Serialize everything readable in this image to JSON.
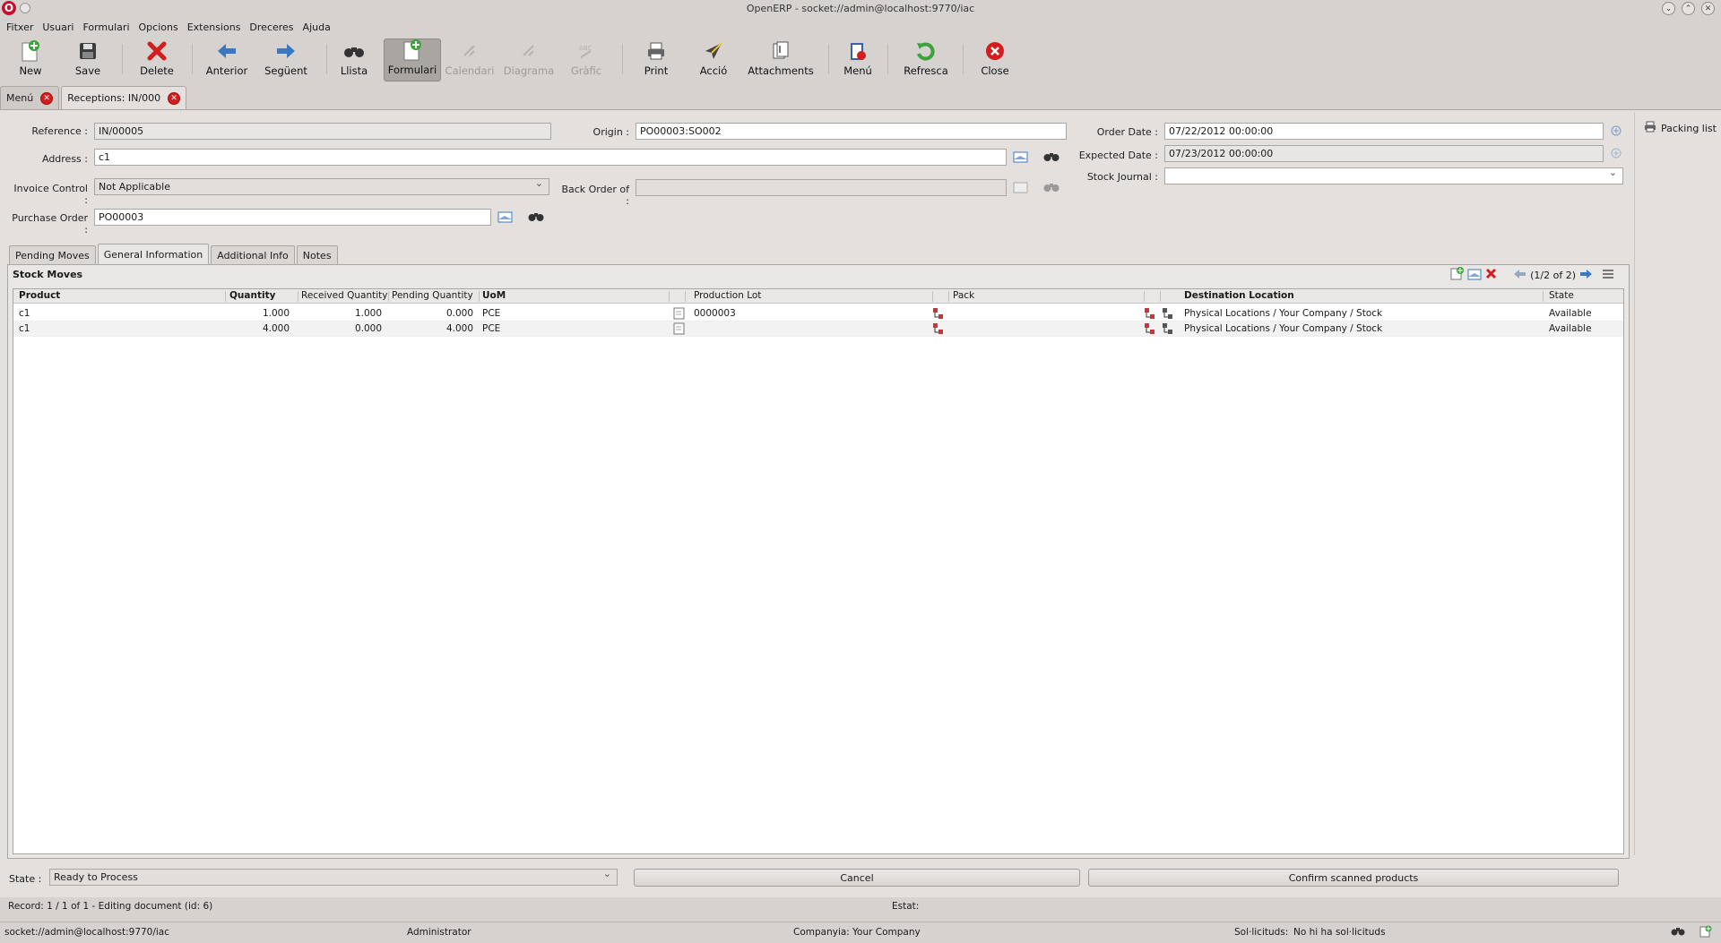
{
  "window": {
    "title": "OpenERP - socket://admin@localhost:9770/iac",
    "logo_letter": "O"
  },
  "menubar": [
    "Fitxer",
    "Usuari",
    "Formulari",
    "Opcions",
    "Extensions",
    "Dreceres",
    "Ajuda"
  ],
  "toolbar": {
    "new": "New",
    "save": "Save",
    "delete": "Delete",
    "prev": "Anterior",
    "next": "Següent",
    "list": "Llista",
    "form": "Formulari",
    "calendar": "Calendari",
    "diagram": "Diagrama",
    "graph": "Gràfic",
    "print": "Print",
    "action": "Acció",
    "attachments": "Attachments",
    "menu": "Menú",
    "refresh": "Refresca",
    "close": "Close"
  },
  "doc_tabs": {
    "menu": "Menú",
    "receptions": "Receptions: IN/000"
  },
  "form": {
    "reference_label": "Reference :",
    "reference": "IN/00005",
    "origin_label": "Origin :",
    "origin": "PO00003:SO002",
    "order_date_label": "Order Date :",
    "order_date": "07/22/2012  00:00:00",
    "address_label": "Address :",
    "address": "c1",
    "expected_date_label": "Expected Date :",
    "expected_date": "07/23/2012  00:00:00",
    "invoice_control_label": "Invoice Control :",
    "invoice_control": "Not Applicable",
    "back_order_label": "Back Order of :",
    "back_order": "",
    "stock_journal_label": "Stock Journal :",
    "stock_journal": "",
    "purchase_order_label": "Purchase Order :",
    "purchase_order": "PO00003"
  },
  "side": {
    "packing_list": "Packing list"
  },
  "inner_tabs": [
    "Pending Moves",
    "General Information",
    "Additional Info",
    "Notes"
  ],
  "stock_moves": {
    "title": "Stock Moves",
    "pager": "(1/2 of 2)",
    "columns": {
      "product": "Product",
      "quantity": "Quantity",
      "received": "Received Quantity",
      "pending": "Pending Quantity",
      "uom": "UoM",
      "lot": "Production Lot",
      "pack": "Pack",
      "destination": "Destination Location",
      "state": "State"
    },
    "rows": [
      {
        "product": "c1",
        "quantity": "1.000",
        "received": "1.000",
        "pending": "0.000",
        "uom": "PCE",
        "lot": "0000003",
        "pack": "",
        "destination": "Physical Locations / Your Company / Stock",
        "state": "Available"
      },
      {
        "product": "c1",
        "quantity": "4.000",
        "received": "0.000",
        "pending": "4.000",
        "uom": "PCE",
        "lot": "",
        "pack": "",
        "destination": "Physical Locations / Your Company / Stock",
        "state": "Available"
      }
    ]
  },
  "bottom": {
    "state_label": "State :",
    "state": "Ready to Process",
    "cancel": "Cancel",
    "confirm": "Confirm scanned products"
  },
  "status": {
    "record": "Record: 1 / 1 of 1 - Editing document (id: 6)",
    "estat": "Estat:"
  },
  "footer": {
    "server": "socket://admin@localhost:9770/iac",
    "user": "Administrator",
    "company_label": "Companyia:",
    "company": "Your Company",
    "requests_label": "Sol·licituds:",
    "requests": "No hi ha sol·licituds"
  },
  "colors": {
    "delete_red": "#d41e1e",
    "nav_blue": "#3b78c4",
    "refresh_green": "#3aa33a"
  }
}
